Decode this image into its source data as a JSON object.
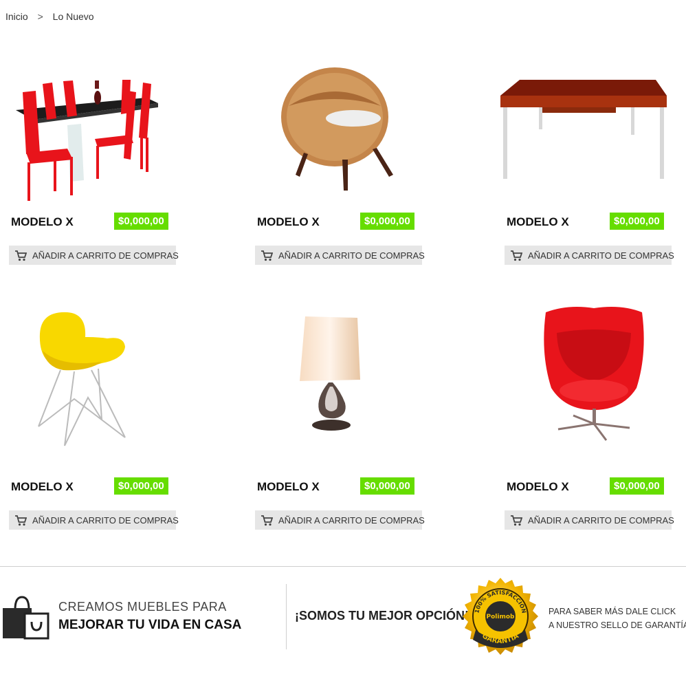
{
  "breadcrumb": {
    "home": "Inicio",
    "separator": ">",
    "current": "Lo Nuevo"
  },
  "products": [
    {
      "name": "MODELO X",
      "price": "$0,000,00",
      "cart_label": "AÑADIR A CARRITO DE COMPRAS",
      "image": "dining-set-image"
    },
    {
      "name": "MODELO X",
      "price": "$0,000,00",
      "cart_label": "AÑADIR A CARRITO DE COMPRAS",
      "image": "wicker-chair-image"
    },
    {
      "name": "MODELO X",
      "price": "$0,000,00",
      "cart_label": "AÑADIR A CARRITO DE COMPRAS",
      "image": "table-image"
    },
    {
      "name": "MODELO X",
      "price": "$0,000,00",
      "cart_label": "AÑADIR A CARRITO DE COMPRAS",
      "image": "yellow-chair-image"
    },
    {
      "name": "MODELO X",
      "price": "$0,000,00",
      "cart_label": "AÑADIR A CARRITO DE COMPRAS",
      "image": "lamp-image"
    },
    {
      "name": "MODELO X",
      "price": "$0,000,00",
      "cart_label": "AÑADIR A CARRITO DE COMPRAS",
      "image": "egg-chair-image"
    }
  ],
  "footer": {
    "line1": "CREAMOS MUEBLES PARA",
    "line2": "MEJORAR TU VIDA EN CASA",
    "slogan": "¡SOMOS TU MEJOR OPCIÓN!",
    "seal_line1": "PARA SABER MÁS DALE CLICK",
    "seal_line2": "A NUESTRO SELLO DE GARANTÍA",
    "seal_top_text": "100% SATISFACCIÓN",
    "seal_brand": "Polimob",
    "seal_bottom_text": "GARANTÍA"
  },
  "colors": {
    "price_bg": "#66dd00",
    "button_bg": "#e6e6e6",
    "accent_red": "#e8141b"
  }
}
